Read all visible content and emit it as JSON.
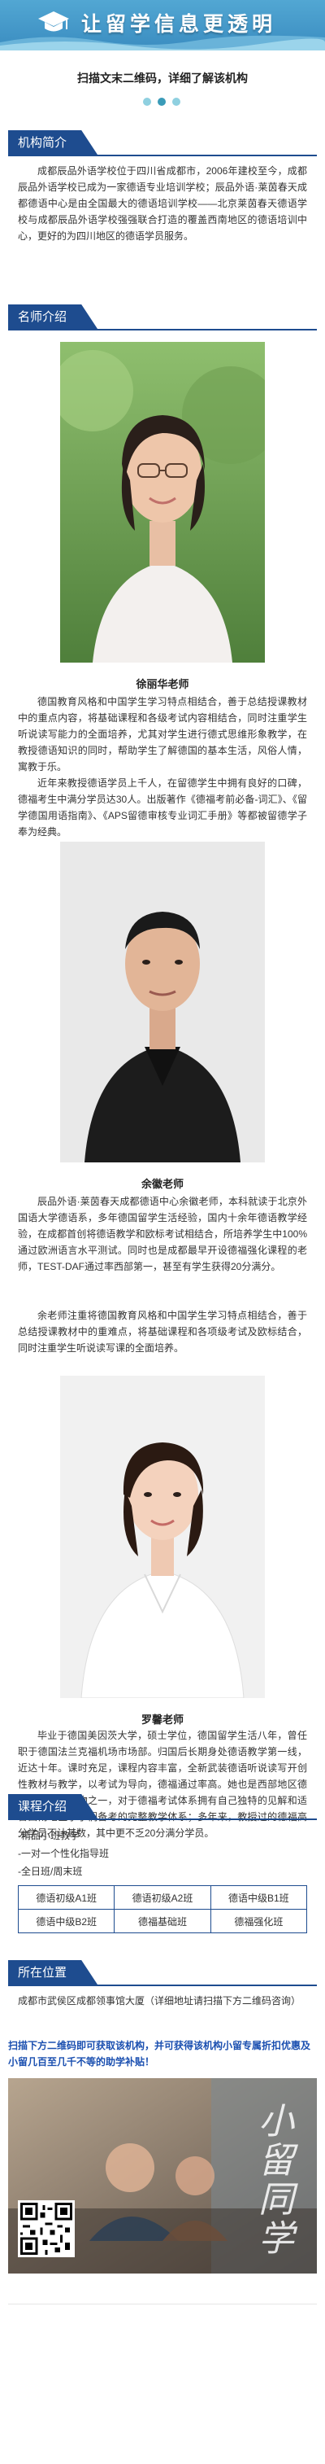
{
  "banner": {
    "title": "让留学信息更透明"
  },
  "subtitle": "扫描文末二维码，详细了解该机构",
  "sections": {
    "intro": "机构简介",
    "teachers": "名师介绍",
    "courses": "课程介绍",
    "location": "所在位置"
  },
  "intro_text": "成都辰品外语学校位于四川省成都市，2006年建校至今，成都辰品外语学校已成为一家德语专业培训学校；辰品外语·莱茵春天成都德语中心是由全国最大的德语培训学校——北京莱茵春天德语学校与成都辰品外语学校强强联合打造的覆盖西南地区的德语培训中心，更好的为四川地区的德语学员服务。",
  "teachers": [
    {
      "name": "徐丽华老师",
      "paras": [
        "德国教育风格和中国学生学习特点相结合，善于总结授课教材中的重点内容，将基础课程和各级考试内容相结合，同时注重学生听说读写能力的全面培养，尤其对学生进行德式思维形象教学，在教授德语知识的同时，帮助学生了解德国的基本生活，风俗人情，寓教于乐。",
        "近年来教授德语学员上千人，在留德学生中拥有良好的口碑，德福考生中满分学员达30人。出版著作《德福考前必备-词汇》、《留学德国用语指南》、《APS留德审核专业词汇手册》等都被留德学子奉为经典。"
      ]
    },
    {
      "name": "余徽老师",
      "paras": [
        "辰品外语·莱茵春天成都德语中心余徽老师，本科就读于北京外国语大学德语系，多年德国留学生活经验，国内十余年德语教学经验，在成都首创将德语教学和欧标考试相结合，所培养学生中100%通过欧洲语言水平测试。同时也是成都最早开设德福强化课程的老师，TEST-DAF通过率西部第一，甚至有学生获得20分满分。",
        "余老师注重将德国教育风格和中国学生学习特点相结合，善于总结授课教材中的重难点，将基础课程和各项级考试及欧标结合，同时注重学生听说读写课的全面培养。"
      ]
    },
    {
      "name": "罗馨老师",
      "paras": [
        "毕业于德国美因茨大学，硕士学位，德国留学生活八年，曾任职于德国法兰克福机场市场部。归国后长期身处德语教学第一线，近达十年。课时充足，课程内容丰富，全新武装德语听说读写开创性教材与教学，以考试为导向，德福通过率高。她也是西部地区德福教学领军人物之一，对于德福考试体系拥有自己独特的见解和适合西南地区学子们备考的完整教学体系；多年来，教授过的德福高分学员不计其数，其中更不乏20分满分学员。"
      ]
    }
  ],
  "courses": {
    "list": [
      "-精品小班教学",
      "-一对一个性化指导班",
      "-全日班/周末班"
    ],
    "table": [
      [
        "德语初级A1班",
        "德语初级A2班",
        "德语中级B1班"
      ],
      [
        "德语中级B2班",
        "德福基础班",
        "德福强化班"
      ]
    ]
  },
  "location_text": "成都市武侯区成都领事馆大厦（详细地址请扫描下方二维码咨询）",
  "promo_text": "扫描下方二维码即可获取该机构，并可获得该机构小留专属折扣优惠及小留几百至几千不等的助学补贴！",
  "bottom": {
    "brand": "小留同学"
  }
}
